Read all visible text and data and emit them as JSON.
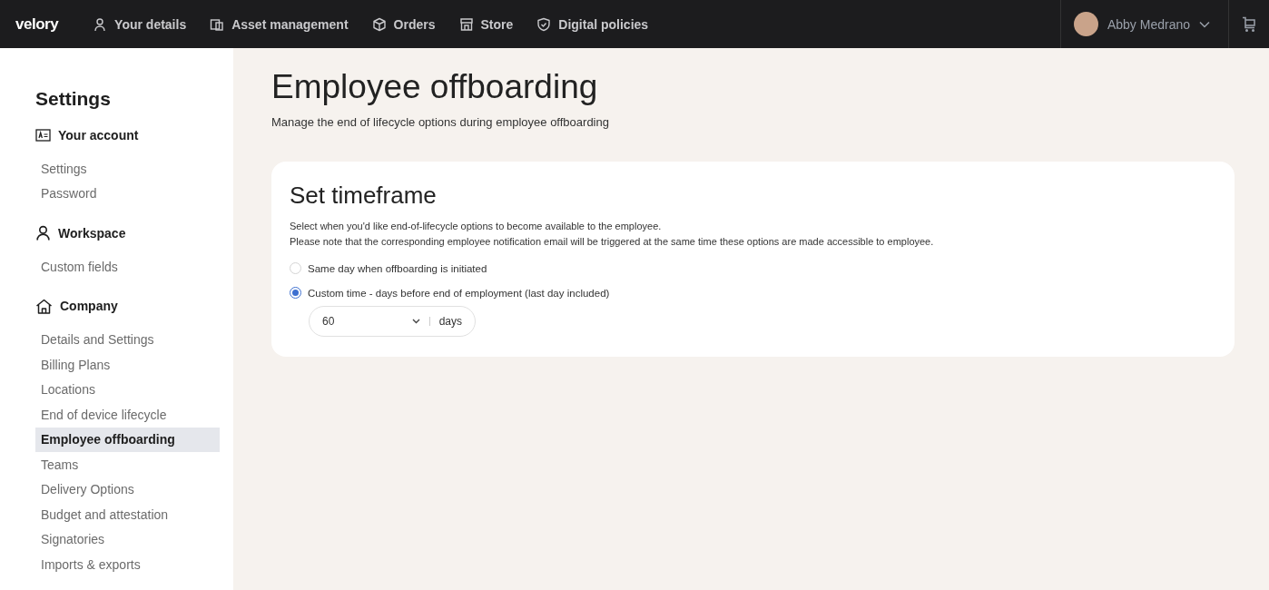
{
  "top_bar": {
    "logo": "velory",
    "nav": [
      {
        "label": "Your details"
      },
      {
        "label": "Asset management"
      },
      {
        "label": "Orders"
      },
      {
        "label": "Store"
      },
      {
        "label": "Digital policies"
      }
    ],
    "user": {
      "name": "Abby Medrano"
    }
  },
  "sidebar": {
    "title": "Settings",
    "groups": [
      {
        "label": "Your account",
        "items": [
          {
            "label": "Settings",
            "selected": false
          },
          {
            "label": "Password",
            "selected": false
          }
        ]
      },
      {
        "label": "Workspace",
        "items": [
          {
            "label": "Custom fields",
            "selected": false
          }
        ]
      },
      {
        "label": "Company",
        "items": [
          {
            "label": "Details and Settings",
            "selected": false
          },
          {
            "label": "Billing Plans",
            "selected": false
          },
          {
            "label": "Locations",
            "selected": false
          },
          {
            "label": "End of device lifecycle",
            "selected": false
          },
          {
            "label": "Employee offboarding",
            "selected": true
          },
          {
            "label": "Teams",
            "selected": false
          },
          {
            "label": "Delivery Options",
            "selected": false
          },
          {
            "label": "Budget and attestation",
            "selected": false
          },
          {
            "label": "Signatories",
            "selected": false
          },
          {
            "label": "Imports & exports",
            "selected": false
          }
        ]
      }
    ]
  },
  "page": {
    "title": "Employee offboarding",
    "subtitle": "Manage the end of lifecycle options during employee offboarding",
    "card": {
      "title": "Set timeframe",
      "description": [
        "Select when you'd like end-of-lifecycle options to become available to the employee.",
        "Please note that the corresponding employee notification email will be triggered at the same time these options are made accessible to employee."
      ],
      "options": [
        {
          "label": "Same day when offboarding is initiated",
          "selected": false
        },
        {
          "label": "Custom time - days before end of employment (last day included)",
          "selected": true
        }
      ],
      "days_select": {
        "value": "60",
        "unit": "days"
      }
    }
  }
}
